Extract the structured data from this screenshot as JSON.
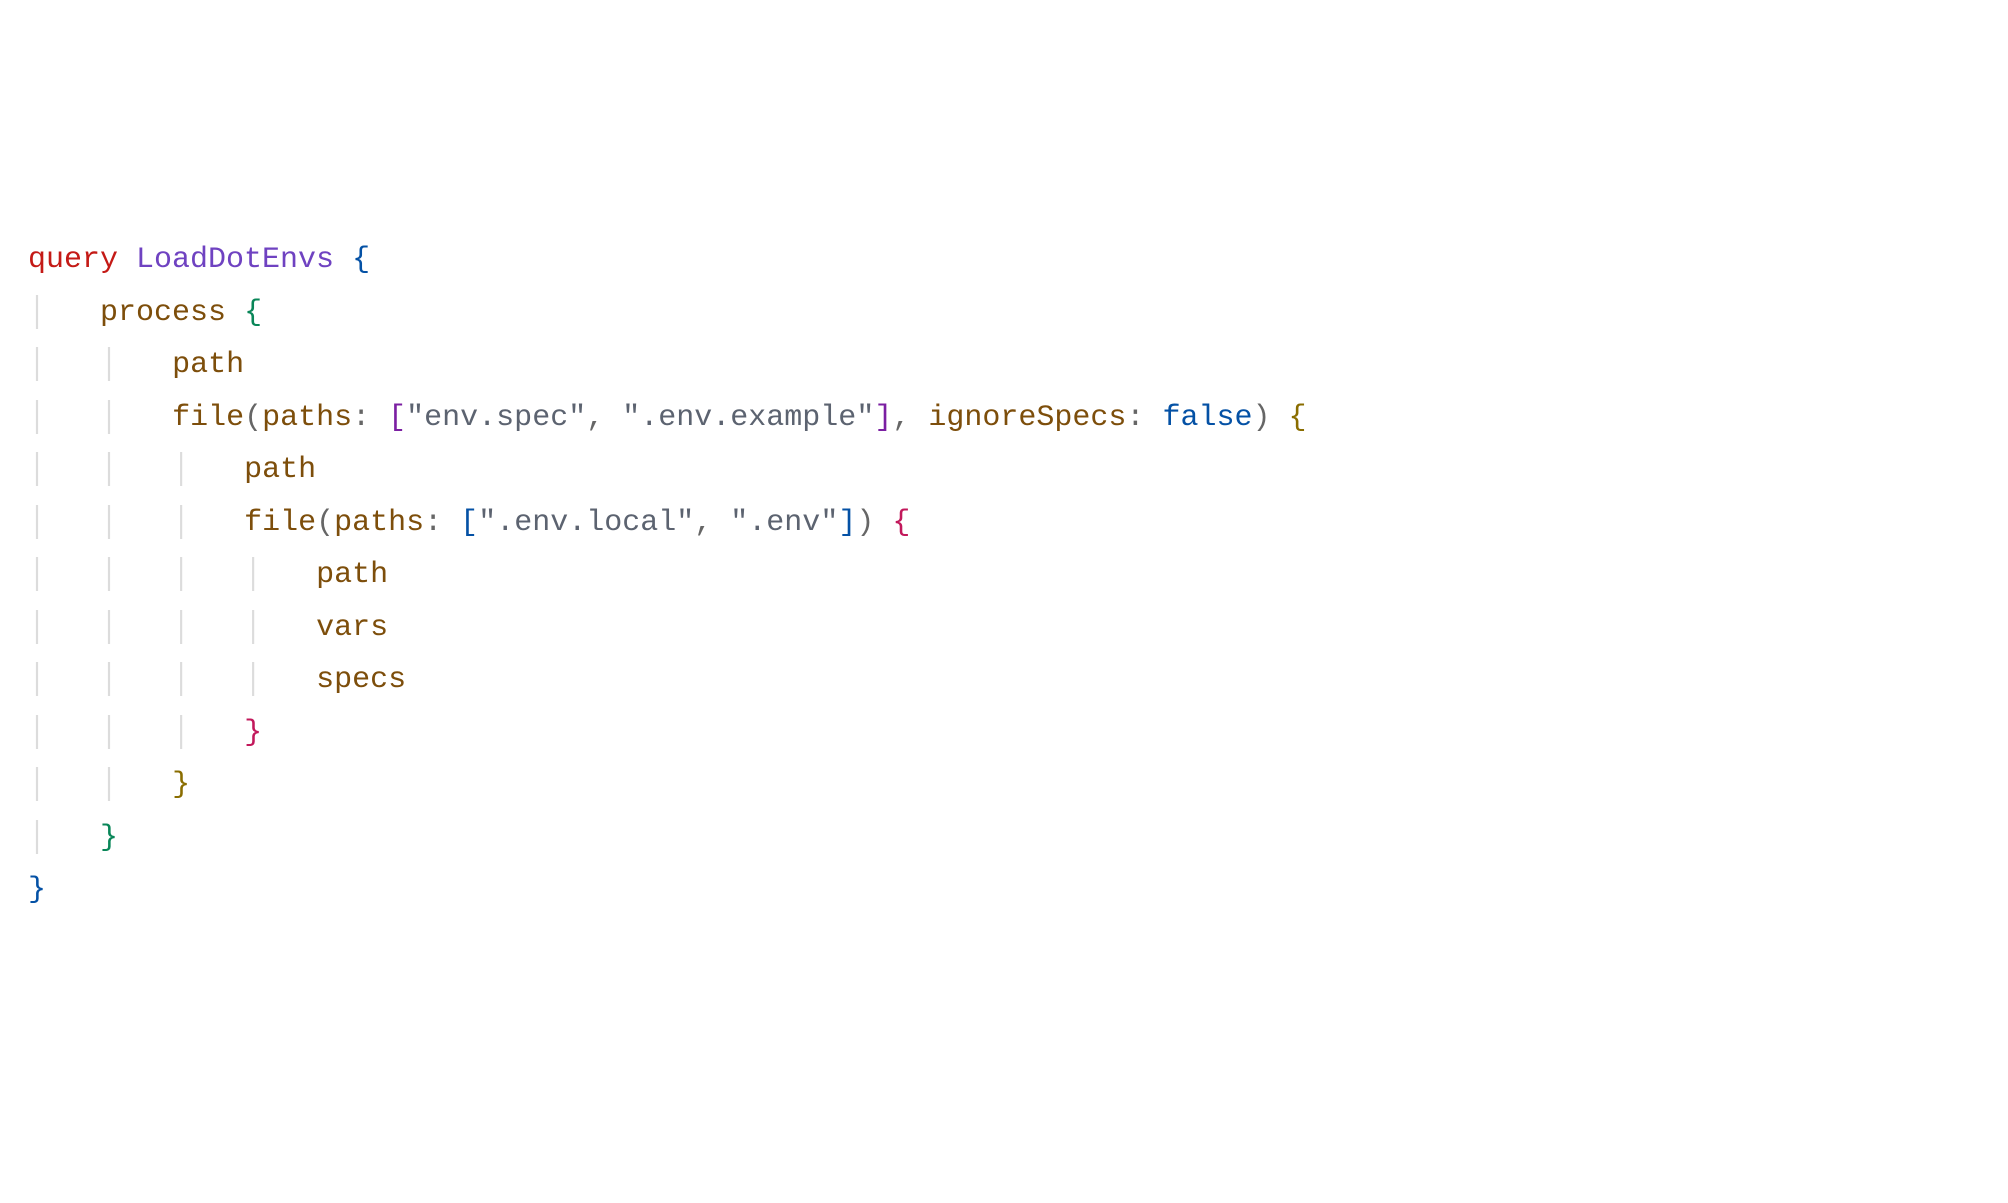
{
  "code": {
    "keyword_query": "query",
    "operation_name": "LoadDotEnvs",
    "field_process": "process",
    "field_path": "path",
    "field_file": "file",
    "arg_paths": "paths",
    "arg_ignoreSpecs": "ignoreSpecs",
    "field_vars": "vars",
    "field_specs": "specs",
    "str_env_spec": "env.spec",
    "str_env_example": ".env.example",
    "str_env_local": ".env.local",
    "str_env": ".env",
    "bool_false": "false",
    "dquote": "\"",
    "lparen": "(",
    "rparen": ")",
    "lbracket": "[",
    "rbracket": "]",
    "lbrace": "{",
    "rbrace": "}",
    "comma": ",",
    "colon": ":",
    "sp": " ",
    "guide": "│"
  }
}
